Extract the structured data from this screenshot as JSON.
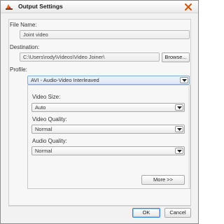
{
  "window": {
    "title": "Output Settings"
  },
  "form": {
    "file_name_label": "File Name:",
    "file_name_value": "Joint video",
    "destination_label": "Destination:",
    "destination_value": "C:\\Users\\rody\\Videos\\Video Joiner\\",
    "browse_label": "Browse...",
    "profile_label": "Profile:",
    "profile_value": "AVI - Audio-Video Interleaved"
  },
  "profile_panel": {
    "video_size_label": "Video Size:",
    "video_size_value": "Auto",
    "video_quality_label": "Video Quality:",
    "video_quality_value": "Normal",
    "audio_quality_label": "Audio Quality:",
    "audio_quality_value": "Normal",
    "more_label": "More >>"
  },
  "footer": {
    "ok_label": "OK",
    "cancel_label": "Cancel"
  },
  "icons": {
    "app": "app-logo-icon",
    "close": "close-icon",
    "dropdown": "chevron-down-icon"
  },
  "colors": {
    "close_x": "#d35400",
    "default_button_border": "#3b88d6"
  }
}
